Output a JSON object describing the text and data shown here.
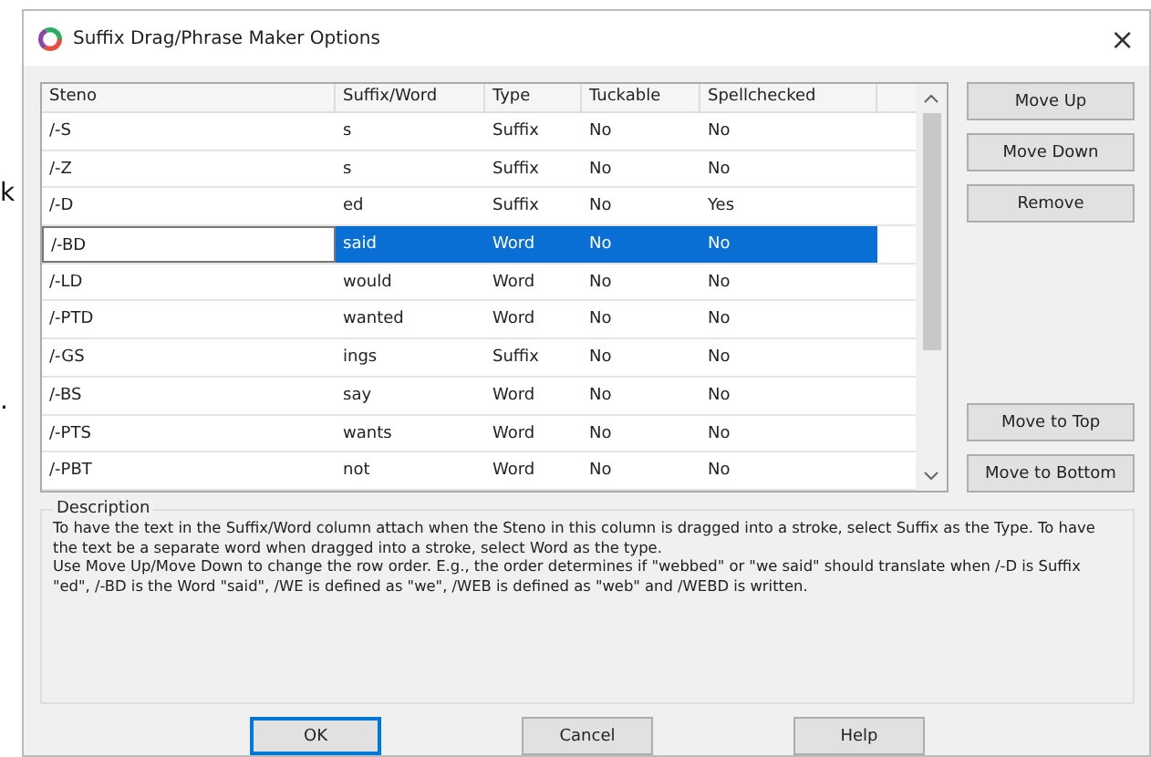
{
  "background_fragments": [
    "k",
    "."
  ],
  "window": {
    "title": "Suffix Drag/Phrase Maker Options",
    "close": "×"
  },
  "table": {
    "columns": [
      "Steno",
      "Suffix/Word",
      "Type",
      "Tuckable",
      "Spellchecked"
    ],
    "rows": [
      {
        "cells": [
          "/-S",
          "s",
          "Suffix",
          "No",
          "No"
        ],
        "selected": false
      },
      {
        "cells": [
          "/-Z",
          "s",
          "Suffix",
          "No",
          "No"
        ],
        "selected": false
      },
      {
        "cells": [
          "/-D",
          "ed",
          "Suffix",
          "No",
          "Yes"
        ],
        "selected": false
      },
      {
        "cells": [
          "/-BD",
          "said",
          "Word",
          "No",
          "No"
        ],
        "selected": true
      },
      {
        "cells": [
          "/-LD",
          "would",
          "Word",
          "No",
          "No"
        ],
        "selected": false
      },
      {
        "cells": [
          "/-PTD",
          "wanted",
          "Word",
          "No",
          "No"
        ],
        "selected": false
      },
      {
        "cells": [
          "/-GS",
          "ings",
          "Suffix",
          "No",
          "No"
        ],
        "selected": false
      },
      {
        "cells": [
          "/-BS",
          "say",
          "Word",
          "No",
          "No"
        ],
        "selected": false
      },
      {
        "cells": [
          "/-PTS",
          "wants",
          "Word",
          "No",
          "No"
        ],
        "selected": false
      },
      {
        "cells": [
          "/-PBT",
          "not",
          "Word",
          "No",
          "No"
        ],
        "selected": false
      }
    ]
  },
  "side_buttons_top": [
    "Move Up",
    "Move Down",
    "Remove"
  ],
  "side_buttons_bottom": [
    "Move to Top",
    "Move to Bottom"
  ],
  "description": {
    "label": "Description",
    "lines": [
      "To have the text in the Suffix/Word column attach when the Steno in this column is dragged into a stroke, select Suffix as the Type. To have the text be a separate word when dragged into a stroke, select Word as the type.",
      "Use Move Up/Move Down to change the row order. E.g., the order determines if \"webbed\" or \"we said\" should translate when /-D is Suffix \"ed\", /-BD is the Word \"said\", /WE is defined as \"we\", /WEB is defined as \"web\" and /WEBD is written."
    ]
  },
  "footer_buttons": [
    {
      "label": "OK",
      "default": true
    },
    {
      "label": "Cancel",
      "default": false
    },
    {
      "label": "Help",
      "default": false
    }
  ]
}
